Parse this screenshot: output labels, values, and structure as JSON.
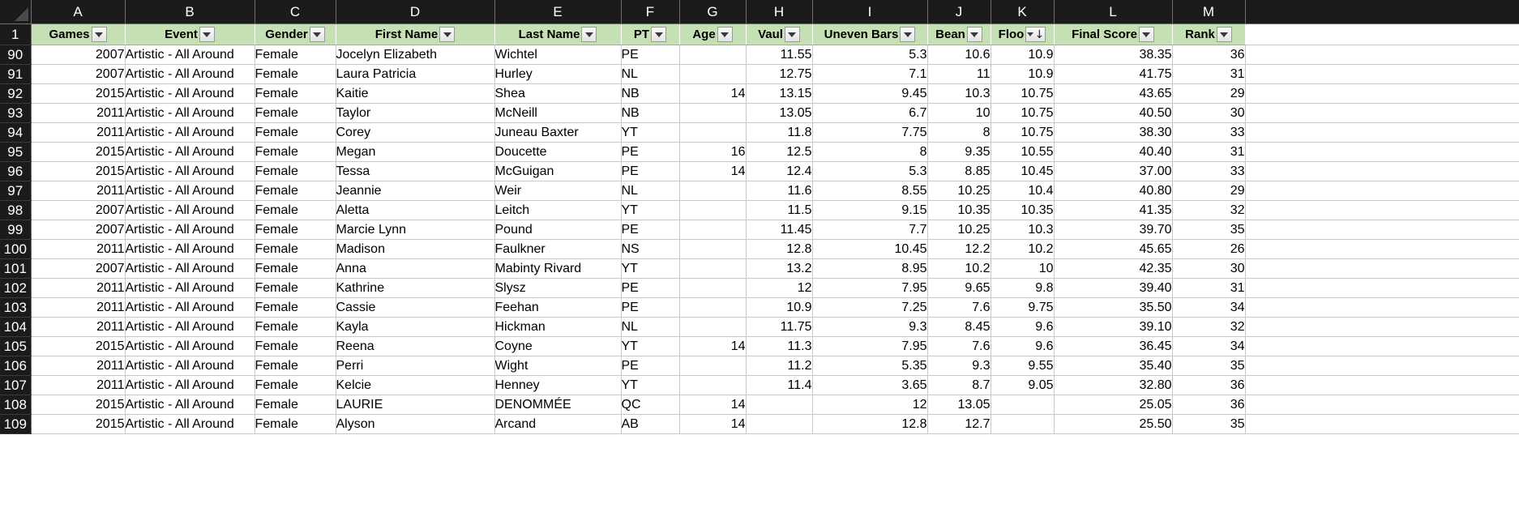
{
  "app": {
    "type": "spreadsheet",
    "select_all_corner": "select-all-triangle"
  },
  "colors": {
    "header_band": "#1b1b1b",
    "filter_header_fill": "#c5e0b4",
    "grid_line": "#c8c8c8",
    "cell_background": "#ffffff",
    "text": "#000000"
  },
  "column_letters": [
    "A",
    "B",
    "C",
    "D",
    "E",
    "F",
    "G",
    "H",
    "I",
    "J",
    "K",
    "L",
    "M"
  ],
  "filter_header": {
    "row_number": "1",
    "columns": [
      {
        "letter": "A",
        "label": "Games",
        "has_filter": true,
        "sorted": false,
        "sort_direction": ""
      },
      {
        "letter": "B",
        "label": "Event",
        "has_filter": true,
        "sorted": false,
        "sort_direction": ""
      },
      {
        "letter": "C",
        "label": "Gender",
        "has_filter": true,
        "sorted": false,
        "sort_direction": ""
      },
      {
        "letter": "D",
        "label": "First Name",
        "has_filter": true,
        "sorted": false,
        "sort_direction": ""
      },
      {
        "letter": "E",
        "label": "Last Name",
        "has_filter": true,
        "sorted": false,
        "sort_direction": ""
      },
      {
        "letter": "F",
        "label": "PT",
        "has_filter": true,
        "sorted": false,
        "sort_direction": ""
      },
      {
        "letter": "G",
        "label": "Age",
        "has_filter": true,
        "sorted": false,
        "sort_direction": ""
      },
      {
        "letter": "H",
        "label": "Vaul",
        "has_filter": true,
        "sorted": false,
        "sort_direction": ""
      },
      {
        "letter": "I",
        "label": "Uneven Bars",
        "has_filter": true,
        "sorted": false,
        "sort_direction": ""
      },
      {
        "letter": "J",
        "label": "Bean",
        "has_filter": true,
        "sorted": false,
        "sort_direction": ""
      },
      {
        "letter": "K",
        "label": "Floo",
        "has_filter": true,
        "sorted": true,
        "sort_direction": "↓"
      },
      {
        "letter": "L",
        "label": "Final Score",
        "has_filter": true,
        "sorted": false,
        "sort_direction": ""
      },
      {
        "letter": "M",
        "label": "Rank",
        "has_filter": true,
        "sorted": false,
        "sort_direction": ""
      }
    ]
  },
  "rows": [
    {
      "n": "90",
      "cells": [
        "2007",
        "Artistic - All Around",
        "Female",
        "Jocelyn Elizabeth",
        "Wichtel",
        "PE",
        "",
        "11.55",
        "5.3",
        "10.6",
        "10.9",
        "38.35",
        "36"
      ]
    },
    {
      "n": "91",
      "cells": [
        "2007",
        "Artistic - All Around",
        "Female",
        "Laura Patricia",
        "Hurley",
        "NL",
        "",
        "12.75",
        "7.1",
        "11",
        "10.9",
        "41.75",
        "31"
      ]
    },
    {
      "n": "92",
      "cells": [
        "2015",
        "Artistic - All Around",
        "Female",
        "Kaitie",
        "Shea",
        "NB",
        "14",
        "13.15",
        "9.45",
        "10.3",
        "10.75",
        "43.65",
        "29"
      ]
    },
    {
      "n": "93",
      "cells": [
        "2011",
        "Artistic - All Around",
        "Female",
        "Taylor",
        "McNeill",
        "NB",
        "",
        "13.05",
        "6.7",
        "10",
        "10.75",
        "40.50",
        "30"
      ]
    },
    {
      "n": "94",
      "cells": [
        "2011",
        "Artistic - All Around",
        "Female",
        "Corey",
        "Juneau Baxter",
        "YT",
        "",
        "11.8",
        "7.75",
        "8",
        "10.75",
        "38.30",
        "33"
      ]
    },
    {
      "n": "95",
      "cells": [
        "2015",
        "Artistic - All Around",
        "Female",
        "Megan",
        "Doucette",
        "PE",
        "16",
        "12.5",
        "8",
        "9.35",
        "10.55",
        "40.40",
        "31"
      ]
    },
    {
      "n": "96",
      "cells": [
        "2015",
        "Artistic - All Around",
        "Female",
        "Tessa",
        "McGuigan",
        "PE",
        "14",
        "12.4",
        "5.3",
        "8.85",
        "10.45",
        "37.00",
        "33"
      ]
    },
    {
      "n": "97",
      "cells": [
        "2011",
        "Artistic - All Around",
        "Female",
        "Jeannie",
        "Weir",
        "NL",
        "",
        "11.6",
        "8.55",
        "10.25",
        "10.4",
        "40.80",
        "29"
      ]
    },
    {
      "n": "98",
      "cells": [
        "2007",
        "Artistic - All Around",
        "Female",
        "Aletta",
        "Leitch",
        "YT",
        "",
        "11.5",
        "9.15",
        "10.35",
        "10.35",
        "41.35",
        "32"
      ]
    },
    {
      "n": "99",
      "cells": [
        "2007",
        "Artistic - All Around",
        "Female",
        "Marcie Lynn",
        "Pound",
        "PE",
        "",
        "11.45",
        "7.7",
        "10.25",
        "10.3",
        "39.70",
        "35"
      ]
    },
    {
      "n": "100",
      "cells": [
        "2011",
        "Artistic - All Around",
        "Female",
        "Madison",
        "Faulkner",
        "NS",
        "",
        "12.8",
        "10.45",
        "12.2",
        "10.2",
        "45.65",
        "26"
      ]
    },
    {
      "n": "101",
      "cells": [
        "2007",
        "Artistic - All Around",
        "Female",
        "Anna",
        "Mabinty Rivard",
        "YT",
        "",
        "13.2",
        "8.95",
        "10.2",
        "10",
        "42.35",
        "30"
      ]
    },
    {
      "n": "102",
      "cells": [
        "2011",
        "Artistic - All Around",
        "Female",
        "Kathrine",
        "Slysz",
        "PE",
        "",
        "12",
        "7.95",
        "9.65",
        "9.8",
        "39.40",
        "31"
      ]
    },
    {
      "n": "103",
      "cells": [
        "2011",
        "Artistic - All Around",
        "Female",
        "Cassie",
        "Feehan",
        "PE",
        "",
        "10.9",
        "7.25",
        "7.6",
        "9.75",
        "35.50",
        "34"
      ]
    },
    {
      "n": "104",
      "cells": [
        "2011",
        "Artistic - All Around",
        "Female",
        "Kayla",
        "Hickman",
        "NL",
        "",
        "11.75",
        "9.3",
        "8.45",
        "9.6",
        "39.10",
        "32"
      ]
    },
    {
      "n": "105",
      "cells": [
        "2015",
        "Artistic - All Around",
        "Female",
        "Reena",
        "Coyne",
        "YT",
        "14",
        "11.3",
        "7.95",
        "7.6",
        "9.6",
        "36.45",
        "34"
      ]
    },
    {
      "n": "106",
      "cells": [
        "2011",
        "Artistic - All Around",
        "Female",
        "Perri",
        "Wight",
        "PE",
        "",
        "11.2",
        "5.35",
        "9.3",
        "9.55",
        "35.40",
        "35"
      ]
    },
    {
      "n": "107",
      "cells": [
        "2011",
        "Artistic - All Around",
        "Female",
        "Kelcie",
        "Henney",
        "YT",
        "",
        "11.4",
        "3.65",
        "8.7",
        "9.05",
        "32.80",
        "36"
      ]
    },
    {
      "n": "108",
      "cells": [
        "2015",
        "Artistic - All Around",
        "Female",
        "LAURIE",
        "DENOMMÉE",
        "QC",
        "14",
        "",
        "12",
        "13.05",
        "",
        "25.05",
        "36"
      ]
    },
    {
      "n": "109",
      "cells": [
        "2015",
        "Artistic - All Around",
        "Female",
        "Alyson",
        "Arcand",
        "AB",
        "14",
        "",
        "12.8",
        "12.7",
        "",
        "25.50",
        "35"
      ]
    }
  ],
  "column_alignment": [
    "num",
    "text",
    "text",
    "text",
    "text",
    "text",
    "num",
    "num",
    "num",
    "num",
    "num",
    "num",
    "num"
  ]
}
